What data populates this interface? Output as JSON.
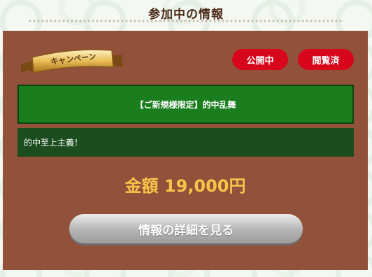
{
  "header": {
    "title": "参加中の情報"
  },
  "campaign_badge": {
    "label": "キャンペーン"
  },
  "status": {
    "public_label": "公開中",
    "viewed_label": "閲覧済"
  },
  "campaign": {
    "title": "【ご新規様限定】的中乱舞"
  },
  "description": {
    "text": "的中至上主義！"
  },
  "amount": {
    "text": "金額 19,000円"
  },
  "detail_button": {
    "label": "情報の詳細を見る"
  },
  "colors": {
    "panel": "#92513a",
    "status_red": "#d8061a",
    "campaign_green": "#1b7e1e",
    "desc_green": "#1c4d1e",
    "amount_gold": "#f7c44a"
  }
}
